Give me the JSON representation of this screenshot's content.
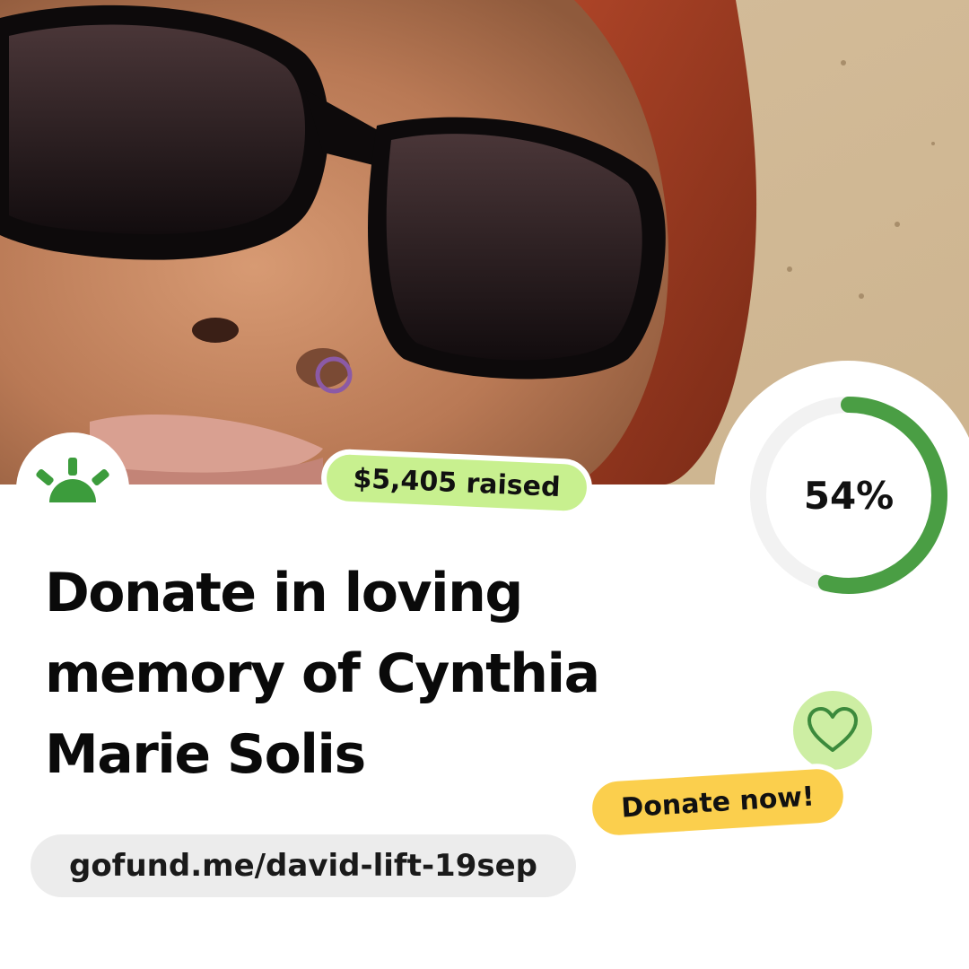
{
  "campaign": {
    "title": "Donate in loving memory of Cynthia Marie Solis",
    "raised_label": "$5,405 raised",
    "progress_percent": 54,
    "progress_label": "54%",
    "donate_button_label": "Donate now!",
    "url": "gofund.me/david-lift-19sep"
  },
  "icons": {
    "logo": "sunrise-logo-icon",
    "heart": "heart-icon"
  },
  "colors": {
    "brand_green": "#3c9c3c",
    "progress_green": "#4a9e44",
    "progress_track": "#f2f2f2",
    "raised_pill": "#c8f08f",
    "heart_badge": "#cdeea3",
    "donate_pill": "#fbcf4d",
    "url_pill": "#ececec"
  }
}
